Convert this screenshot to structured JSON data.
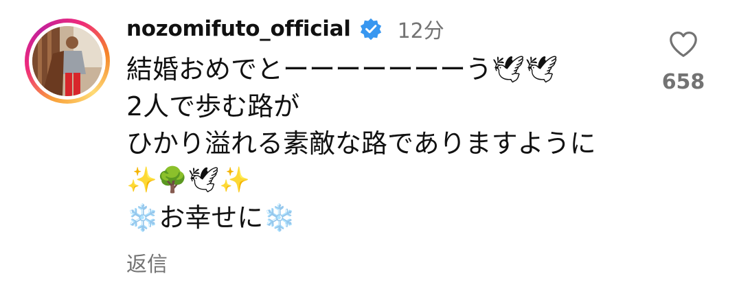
{
  "comment": {
    "username": "nozomifuto_official",
    "verified": true,
    "timestamp": "12分",
    "lines": [
      "結婚おめでとーーーーーーーう🕊🕊",
      "2人で歩む路が",
      "ひかり溢れる素敵な路でありますように",
      "✨🌳🕊✨",
      "❄️お幸せに❄️"
    ],
    "reply_label": "返信",
    "like_count": "658",
    "icons": {
      "avatar": "profile-photo",
      "verified": "verified-badge-icon",
      "like": "heart-outline-icon"
    },
    "colors": {
      "verified_badge": "#3897f0",
      "secondary_text": "#737373",
      "story_ring_start": "#f9a13a",
      "story_ring_end": "#ee2a7b"
    }
  }
}
